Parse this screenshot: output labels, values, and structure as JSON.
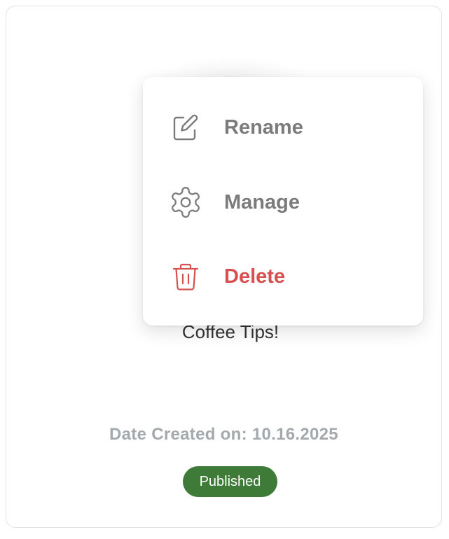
{
  "card": {
    "title": "Coffee Tips!",
    "date_created": "Date Created on: 10.16.2025",
    "status": "Published"
  },
  "menu": {
    "items": [
      {
        "label": "Rename",
        "icon": "edit-icon",
        "color": "#7b7b7b"
      },
      {
        "label": "Manage",
        "icon": "gear-icon",
        "color": "#7b7b7b"
      },
      {
        "label": "Delete",
        "icon": "trash-icon",
        "color": "#d6504f"
      }
    ]
  },
  "colors": {
    "badge": "#3e7b39",
    "danger": "#d6504f",
    "muted_text": "#a4a9ae"
  }
}
